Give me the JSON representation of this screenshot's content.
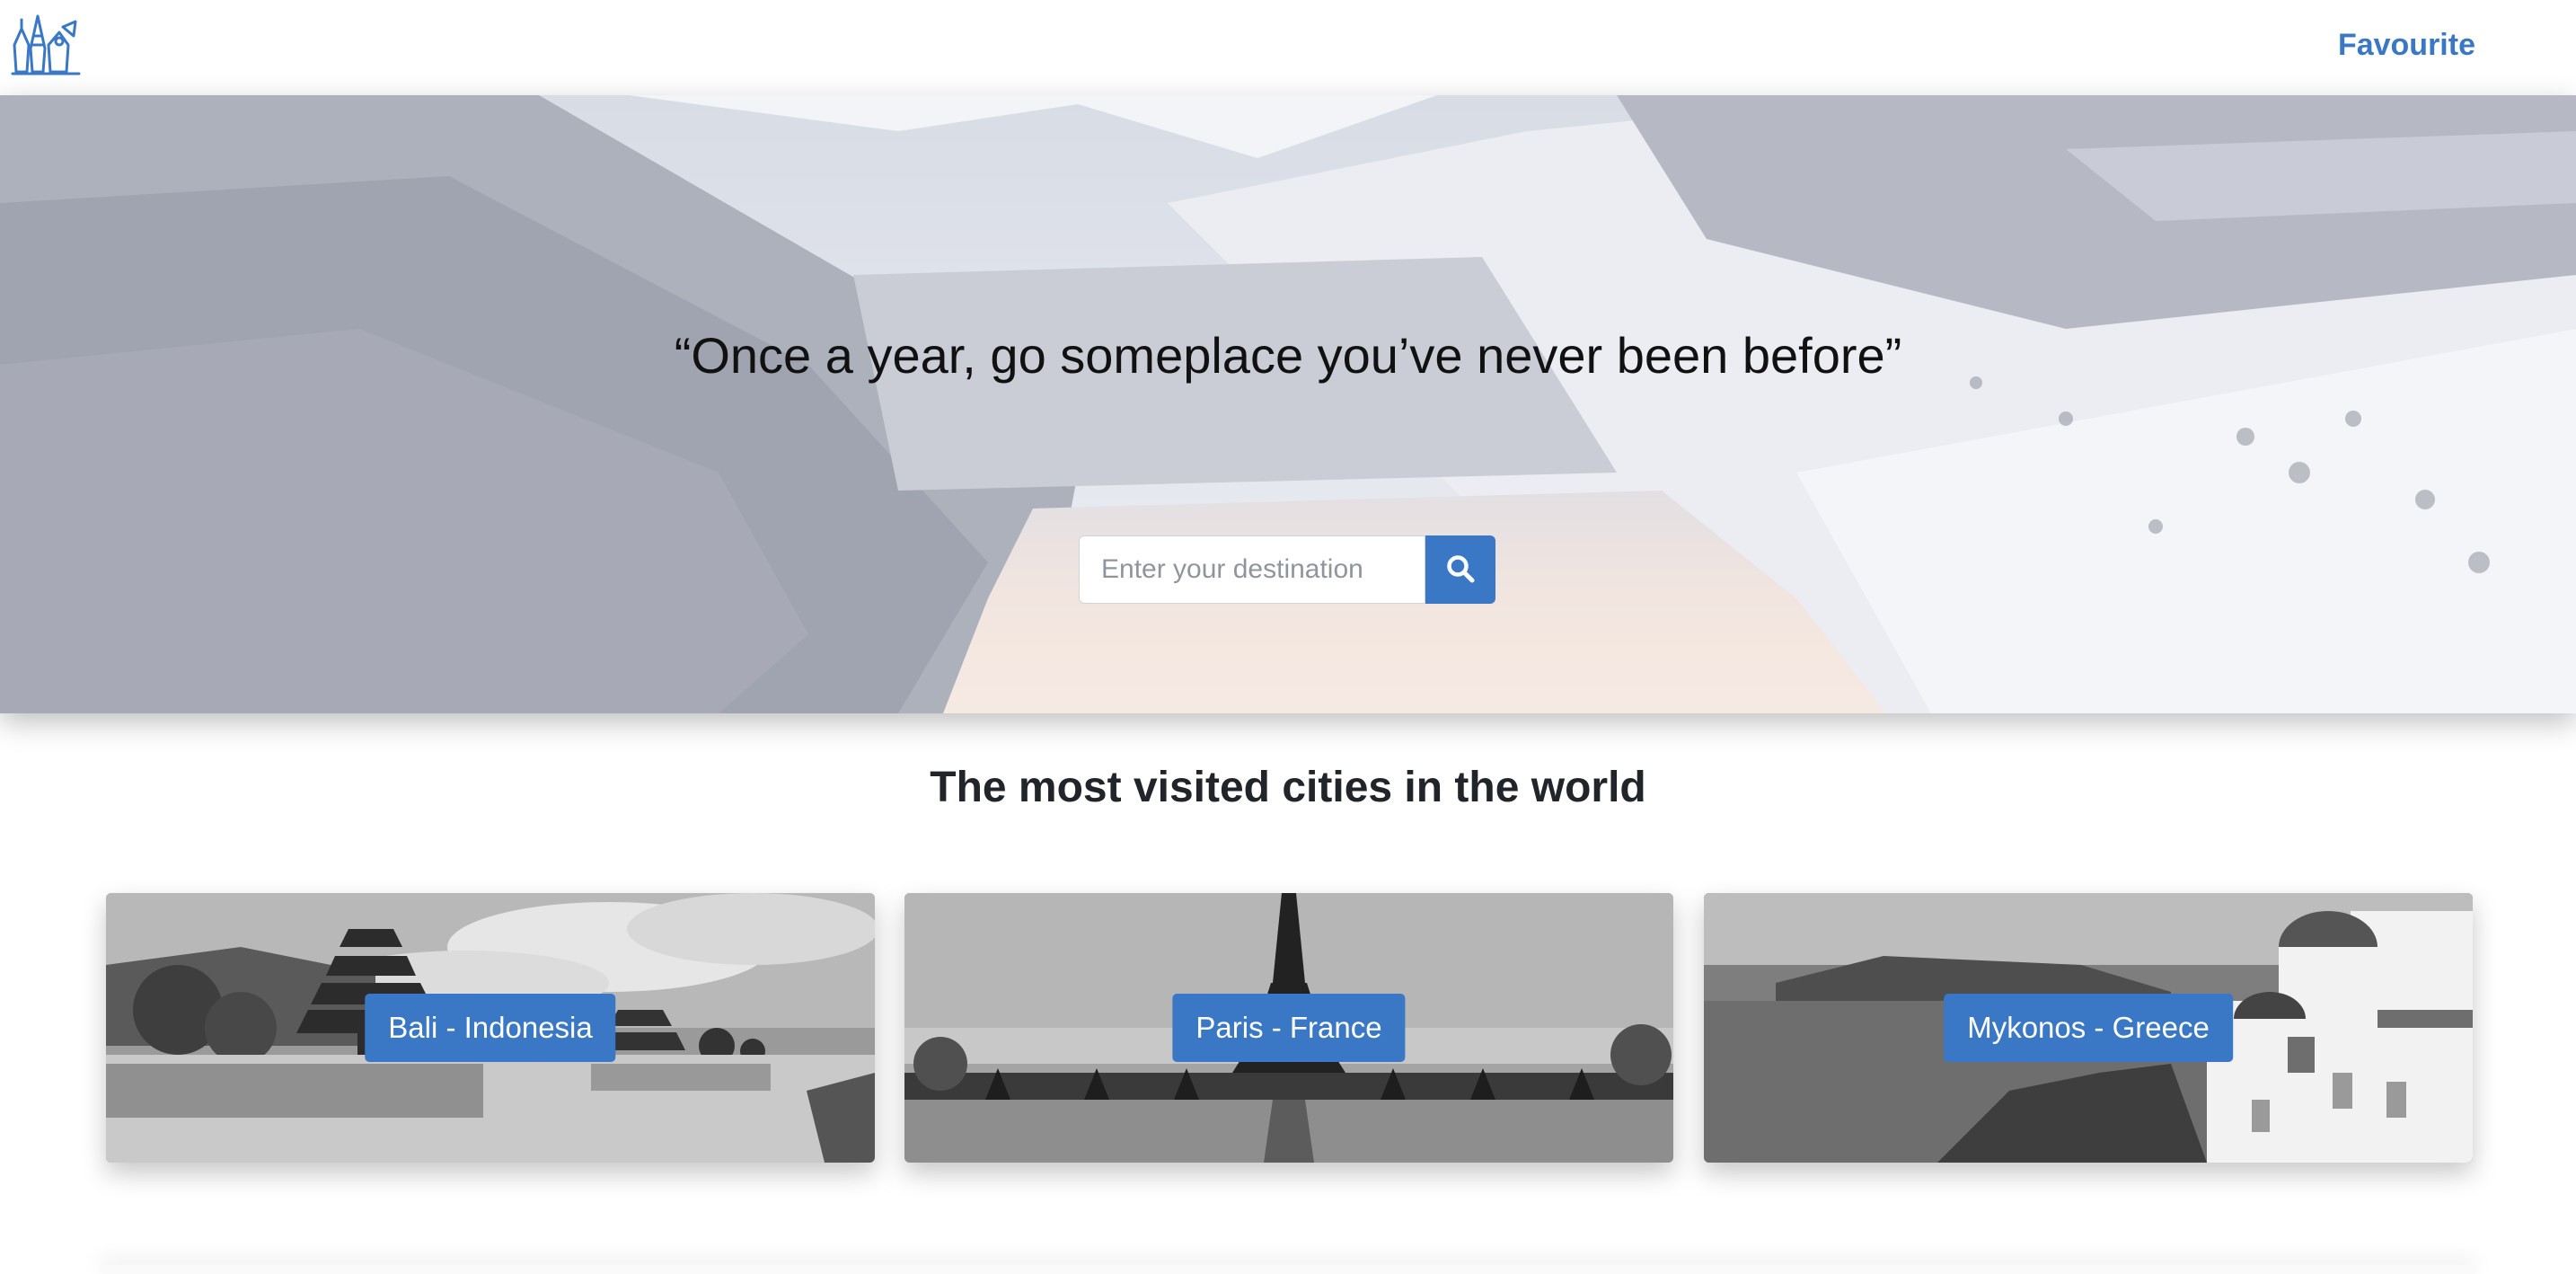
{
  "navbar": {
    "logo_icon": "travel-landmarks-logo-icon",
    "favourite_label": "Favourite"
  },
  "hero": {
    "quote": "“Once a year, go someplace you’ve never been before”",
    "background": "snowy-mountain-valley-lake",
    "search": {
      "placeholder": "Enter your destination",
      "value": "",
      "button_icon": "search-icon"
    }
  },
  "section": {
    "title": "The most visited cities in the world"
  },
  "cities": [
    {
      "label": "Bali - Indonesia",
      "image": "bali-temple-lake-photo"
    },
    {
      "label": "Paris - France",
      "image": "eiffel-tower-photo"
    },
    {
      "label": "Mykonos - Greece",
      "image": "greek-island-white-houses-photo"
    }
  ],
  "colors": {
    "accent": "#3a78c6",
    "title_text": "#212529"
  }
}
